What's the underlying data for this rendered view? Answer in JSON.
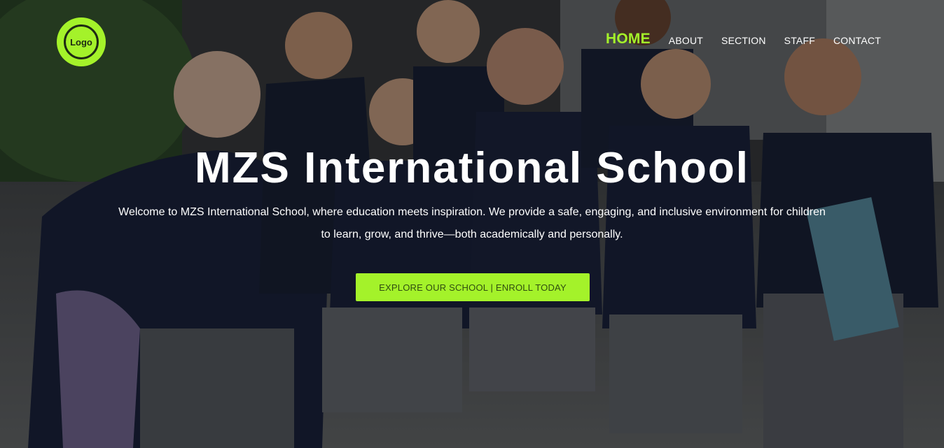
{
  "brand": {
    "logo_text": "Logo",
    "accent_color": "#a4f22a"
  },
  "nav": {
    "items": [
      {
        "label": "HOME",
        "active": true
      },
      {
        "label": "ABOUT",
        "active": false
      },
      {
        "label": "SECTION",
        "active": false
      },
      {
        "label": "STAFF",
        "active": false
      },
      {
        "label": "CONTACT",
        "active": false
      }
    ]
  },
  "hero": {
    "title": "MZS International School",
    "description": "Welcome to MZS International School, where education meets inspiration. We provide a safe, engaging, and inclusive environment for children to learn, grow, and thrive—both academically and personally.",
    "cta_label": "EXPLORE OUR SCHOOL | ENROLL TODAY",
    "background": "photo of smiling students in navy school uniforms"
  }
}
